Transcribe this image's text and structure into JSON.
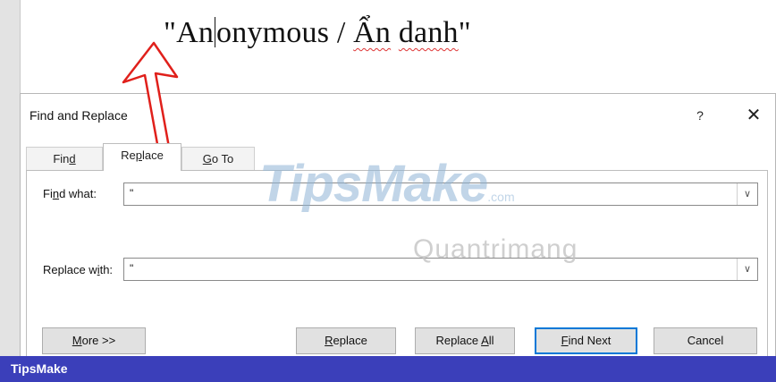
{
  "document": {
    "text_before_caret": "\"An",
    "text_word1_rest": "onymous",
    "text_sep": " / ",
    "text_word2": "Ẩn",
    "text_space": " ",
    "text_word3": "danh",
    "text_close": "\""
  },
  "dialog": {
    "title": "Find and Replace",
    "help_label": "?",
    "close_label": "✕",
    "tabs": [
      {
        "label_pre": "Fin",
        "label_key": "d",
        "label_post": ""
      },
      {
        "label_pre": "Re",
        "label_key": "p",
        "label_post": "lace"
      },
      {
        "label_pre": "",
        "label_key": "G",
        "label_post": "o To"
      }
    ],
    "find_what": {
      "label_pre": "Fi",
      "label_key": "n",
      "label_post": "d what:",
      "value": "\""
    },
    "replace_with": {
      "label_pre": "Replace w",
      "label_key": "i",
      "label_post": "th:",
      "value": "\""
    },
    "buttons": {
      "more": {
        "label_pre": "",
        "label_key": "M",
        "label_post": "ore >>"
      },
      "replace": {
        "label_pre": "",
        "label_key": "R",
        "label_post": "eplace"
      },
      "replace_all": {
        "label_pre": "Replace ",
        "label_key": "A",
        "label_post": "ll"
      },
      "find_next": {
        "label_pre": "",
        "label_key": "F",
        "label_post": "ind Next"
      },
      "cancel": {
        "label": "Cancel"
      }
    },
    "dropdown_glyph": "∨"
  },
  "watermarks": {
    "tipsmake": "TipsMake",
    "tipsmake_suffix": ".com",
    "quantrimang": "Quantrimang"
  },
  "footer": {
    "label": "TipsMake",
    "color": "#3b3fba"
  },
  "colors": {
    "accent": "#0078d7",
    "annotation_arrow": "#e0201b"
  }
}
